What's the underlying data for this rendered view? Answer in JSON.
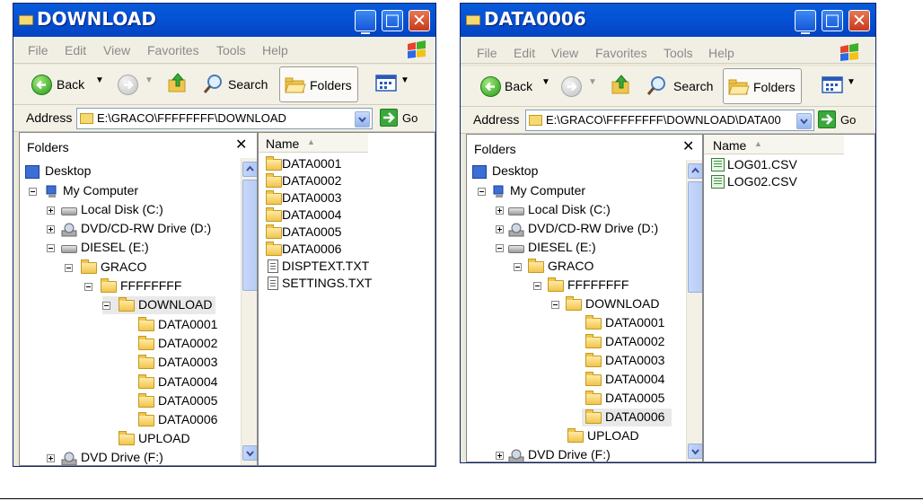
{
  "left": {
    "title": "DOWNLOAD",
    "menu": [
      "File",
      "Edit",
      "View",
      "Favorites",
      "Tools",
      "Help"
    ],
    "toolbar": {
      "back": "Back",
      "search": "Search",
      "folders": "Folders"
    },
    "address_label": "Address",
    "address_value": "E:\\GRACO\\FFFFFFFF\\DOWNLOAD",
    "go_label": "Go",
    "folders_header": "Folders",
    "tree": [
      "Desktop",
      "My Computer",
      "Local Disk (C:)",
      "DVD/CD-RW Drive (D:)",
      "DIESEL (E:)",
      "GRACO",
      "FFFFFFFF",
      "DOWNLOAD",
      "DATA0001",
      "DATA0002",
      "DATA0003",
      "DATA0004",
      "DATA0005",
      "DATA0006",
      "UPLOAD",
      "DVD Drive (F:)"
    ],
    "column_name": "Name",
    "files": [
      "DATA0001",
      "DATA0002",
      "DATA0003",
      "DATA0004",
      "DATA0005",
      "DATA0006",
      "DISPTEXT.TXT",
      "SETTINGS.TXT"
    ]
  },
  "right": {
    "title": "DATA0006",
    "menu": [
      "File",
      "Edit",
      "View",
      "Favorites",
      "Tools",
      "Help"
    ],
    "toolbar": {
      "back": "Back",
      "search": "Search",
      "folders": "Folders"
    },
    "address_label": "Address",
    "address_value": "E:\\GRACO\\FFFFFFFF\\DOWNLOAD\\DATA00",
    "go_label": "Go",
    "folders_header": "Folders",
    "tree": [
      "Desktop",
      "My Computer",
      "Local Disk (C:)",
      "DVD/CD-RW Drive (D:)",
      "DIESEL (E:)",
      "GRACO",
      "FFFFFFFF",
      "DOWNLOAD",
      "DATA0001",
      "DATA0002",
      "DATA0003",
      "DATA0004",
      "DATA0005",
      "DATA0006",
      "UPLOAD",
      "DVD Drive (F:)"
    ],
    "column_name": "Name",
    "files": [
      "LOG01.CSV",
      "LOG02.CSV"
    ]
  },
  "colors": {
    "titlebar": "#0452d6",
    "chrome": "#ece9d8",
    "close": "#c8391a"
  }
}
